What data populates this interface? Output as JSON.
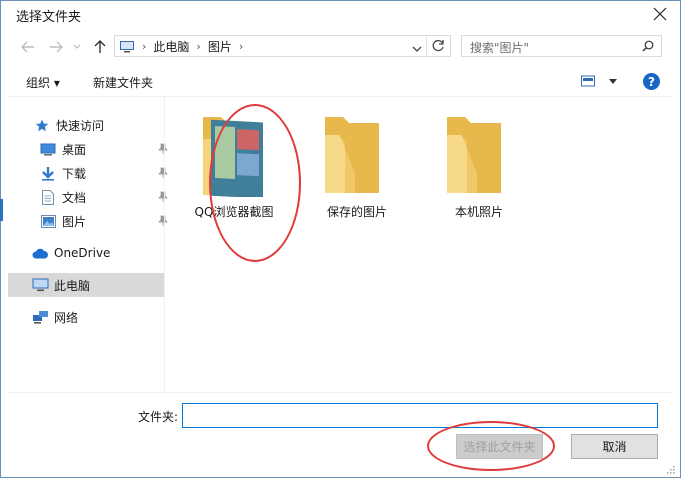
{
  "window": {
    "title": "选择文件夹"
  },
  "address": {
    "breadcrumbs": [
      "此电脑",
      "图片"
    ]
  },
  "search": {
    "placeholder": "搜索\"图片\""
  },
  "toolbar": {
    "organize_label": "组织 ▾",
    "new_folder_label": "新建文件夹"
  },
  "sidebar": {
    "items": [
      {
        "label": "快速访问",
        "icon": "star-icon"
      },
      {
        "label": "桌面",
        "icon": "desktop-icon",
        "pinned": true
      },
      {
        "label": "下载",
        "icon": "download-icon",
        "pinned": true
      },
      {
        "label": "文档",
        "icon": "document-icon",
        "pinned": true
      },
      {
        "label": "图片",
        "icon": "pictures-icon",
        "pinned": true
      },
      {
        "label": "OneDrive",
        "icon": "cloud-icon"
      },
      {
        "label": "此电脑",
        "icon": "computer-icon",
        "selected": true
      },
      {
        "label": "网络",
        "icon": "network-icon"
      }
    ]
  },
  "folders": [
    {
      "label": "QQ浏览器截图",
      "icon": "folder-with-image-icon"
    },
    {
      "label": "保存的图片",
      "icon": "folder-icon"
    },
    {
      "label": "本机照片",
      "icon": "folder-icon"
    }
  ],
  "footer": {
    "folder_label": "文件夹:",
    "folder_value": "",
    "select_button": "选择此文件夹",
    "cancel_button": "取消"
  },
  "colors": {
    "accent": "#0078d7",
    "folder": "#f5d37a",
    "annotation": "#e03a3a",
    "help": "#1a66c6"
  }
}
